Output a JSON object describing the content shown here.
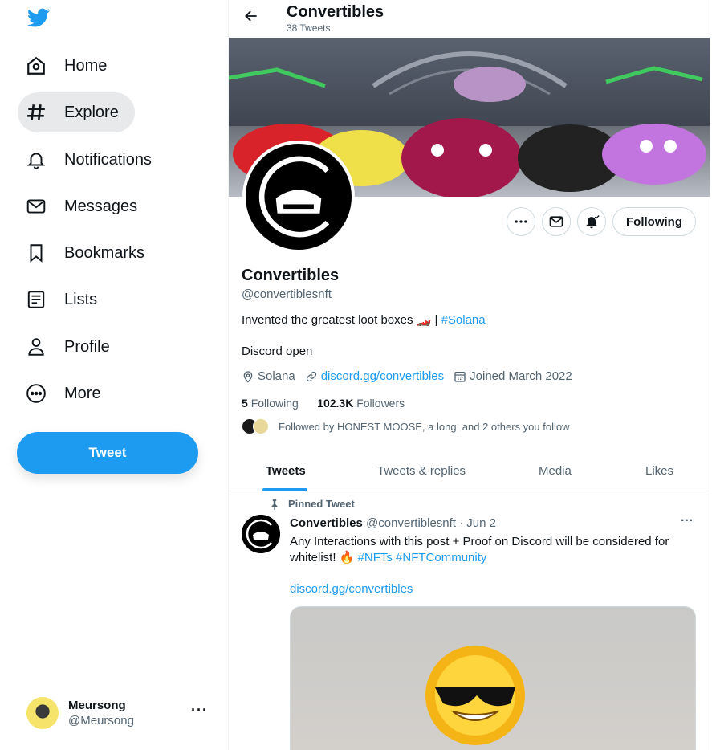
{
  "sidebar": {
    "items": [
      {
        "label": "Home",
        "icon": "home-icon"
      },
      {
        "label": "Explore",
        "icon": "hashtag-icon"
      },
      {
        "label": "Notifications",
        "icon": "bell-icon"
      },
      {
        "label": "Messages",
        "icon": "envelope-icon"
      },
      {
        "label": "Bookmarks",
        "icon": "bookmark-icon"
      },
      {
        "label": "Lists",
        "icon": "list-icon"
      },
      {
        "label": "Profile",
        "icon": "person-icon"
      },
      {
        "label": "More",
        "icon": "more-circle-icon"
      }
    ],
    "active_item": "Explore",
    "tweet_button": "Tweet",
    "account": {
      "display_name": "Meursong",
      "handle": "@Meursong",
      "more": "···"
    }
  },
  "header": {
    "title": "Convertibles",
    "subtitle": "38 Tweets"
  },
  "profile": {
    "name": "Convertibles",
    "handle": "@convertiblesnft",
    "bio_text": "Invented the greatest loot boxes 🏎️ | ",
    "bio_tag": "#Solana",
    "bio_line2": "Discord open",
    "location": "Solana",
    "website": "discord.gg/convertibles",
    "joined": "Joined March 2022",
    "following_count": "5",
    "following_label": "Following",
    "followers_count": "102.3K",
    "followers_label": "Followers",
    "followed_by": "Followed by HONEST MOOSE, a long, and 2 others you follow",
    "following_button": "Following"
  },
  "tabs": [
    "Tweets",
    "Tweets & replies",
    "Media",
    "Likes"
  ],
  "active_tab": "Tweets",
  "pinned_tweet": {
    "pinned_label": "Pinned Tweet",
    "author": "Convertibles",
    "meta": "@convertiblesnft · Jun 2",
    "text": "Any Interactions with this post + Proof on Discord will be considered for whitelist! 🔥 ",
    "tags": "#NFTs #NFTCommunity",
    "link": "discord.gg/convertibles",
    "more": "···"
  },
  "colors": {
    "accent": "#1d9bf0",
    "text": "#0f1419",
    "muted": "#536471",
    "border": "#cfd9de"
  }
}
